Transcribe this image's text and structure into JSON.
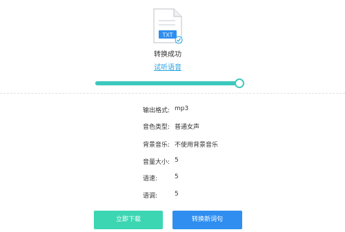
{
  "file": {
    "badge": "TXT",
    "icon": "txt-file-icon"
  },
  "status": {
    "title": "转换成功",
    "preview_link": "试听语音"
  },
  "progress": {
    "value": 1.0,
    "color": "#3dc8be"
  },
  "settings": [
    {
      "label": "输出格式:",
      "value": "mp3"
    },
    {
      "label": "音色类型:",
      "value": "普通女声"
    },
    {
      "label": "背景音乐:",
      "value": "不使用背景音乐"
    },
    {
      "label": "音量大小:",
      "value": "5"
    },
    {
      "label": "语速:",
      "value": "5"
    },
    {
      "label": "语调:",
      "value": "5"
    }
  ],
  "actions": {
    "download": "立即下载",
    "convert_new": "转换新词句"
  },
  "colors": {
    "accent_green": "#3dd6b3",
    "accent_blue": "#2f8ef0",
    "link": "#2aa3e0"
  }
}
